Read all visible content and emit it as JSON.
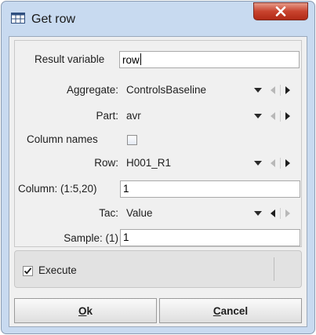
{
  "window": {
    "title": "Get row",
    "close_icon": "close-icon",
    "app_icon": "table-icon"
  },
  "form": {
    "result_variable": {
      "label": "Result variable",
      "value": "row"
    },
    "aggregate": {
      "label": "Aggregate:",
      "value": "ControlsBaseline"
    },
    "part": {
      "label": "Part:",
      "value": "avr"
    },
    "column_names": {
      "label": "Column names",
      "checked": false
    },
    "row": {
      "label": "Row:",
      "value": "H001_R1"
    },
    "column": {
      "label": "Column: (1:5,20)",
      "value": "1"
    },
    "tac": {
      "label": "Tac:",
      "value": "Value"
    },
    "sample": {
      "label": "Sample: (1)",
      "value": "1"
    }
  },
  "execute": {
    "label": "Execute",
    "checked": true
  },
  "buttons": {
    "ok": {
      "mnemonic": "O",
      "rest": "k"
    },
    "cancel": {
      "mnemonic": "C",
      "rest": "ancel"
    }
  },
  "colors": {
    "titlebar": "#c8daf0",
    "close": "#c8432e",
    "panel": "#f0f0f0"
  }
}
